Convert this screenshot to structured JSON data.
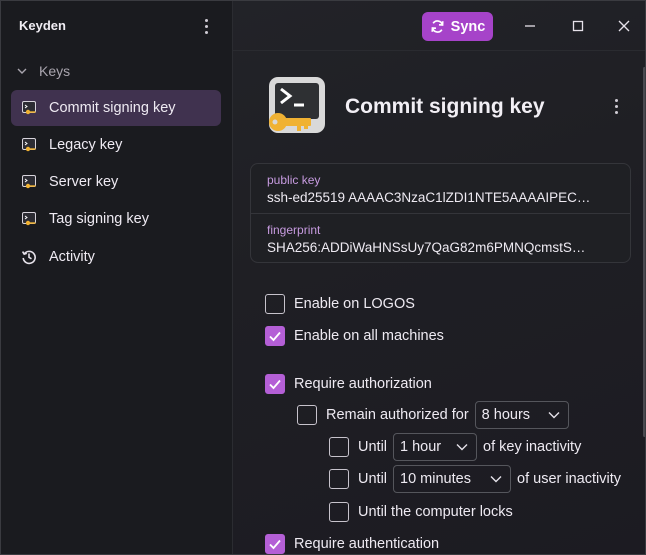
{
  "app": {
    "title": "Keyden"
  },
  "sidebar": {
    "group_label": "Keys",
    "items": [
      {
        "label": "Commit signing key",
        "icon": "key-image-icon",
        "active": true
      },
      {
        "label": "Legacy key",
        "icon": "key-image-icon",
        "active": false
      },
      {
        "label": "Server key",
        "icon": "key-image-icon",
        "active": false
      },
      {
        "label": "Tag signing key",
        "icon": "key-image-icon",
        "active": false
      }
    ],
    "activity_label": "Activity"
  },
  "toolbar": {
    "sync_label": "Sync"
  },
  "key": {
    "title": "Commit signing key",
    "public_key_label": "public key",
    "public_key_value": "ssh-ed25519 AAAAC3NzaC1lZDI1NTE5AAAAIPEC…",
    "fingerprint_label": "fingerprint",
    "fingerprint_value": "SHA256:ADDiWaHNSsUy7QaG82m6PMNQcmstS…"
  },
  "options": {
    "enable_logos": {
      "label": "Enable on LOGOS",
      "checked": false
    },
    "enable_all": {
      "label": "Enable on all machines",
      "checked": true
    },
    "require_authorization": {
      "label": "Require authorization",
      "checked": true
    },
    "remain_authorized": {
      "label": "Remain authorized for",
      "checked": false,
      "select_value": "8 hours"
    },
    "until_key_inactivity": {
      "prefix": "Until",
      "select_value": "1 hour",
      "suffix": "of key inactivity",
      "checked": false
    },
    "until_user_inactivity": {
      "prefix": "Until",
      "select_value": "10 minutes",
      "suffix": "of user inactivity",
      "checked": false
    },
    "until_locks": {
      "label": "Until the computer locks",
      "checked": false
    },
    "require_authentication": {
      "label": "Require authentication",
      "checked": true
    }
  },
  "colors": {
    "accent": "#b45fd6",
    "sync_button": "#a643c9",
    "active_item": "#40324f",
    "label_purple": "#c79be0"
  }
}
